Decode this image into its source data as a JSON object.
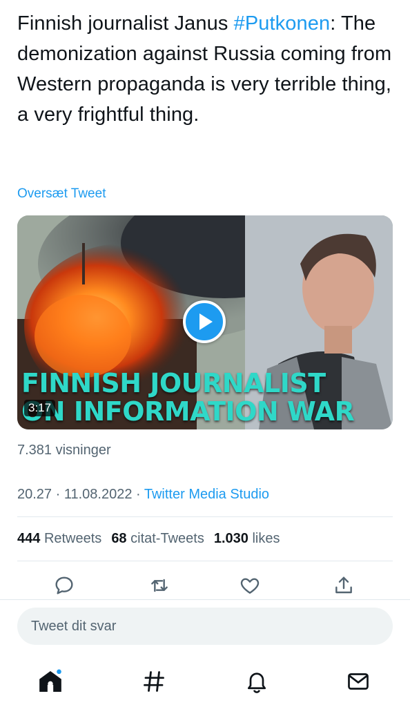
{
  "tweet": {
    "text_line1_prefix": "Finnish journalist Janus ",
    "hashtag": "#Putkonen",
    "text_rest": ": The demonization against Russia coming from Western propaganda is very terrible thing, a very frightful thing.",
    "translate_label": "Oversæt Tweet"
  },
  "video": {
    "caption_line1": "FINNISH JOURNALIST",
    "caption_line2": "ON INFORMATION WAR",
    "duration": "3:17"
  },
  "views_text": "7.381 visninger",
  "meta": {
    "time_date": "20.27 · 11.08.2022 · ",
    "source": "Twitter Media Studio"
  },
  "stats": {
    "retweets_count": "444",
    "retweets_label": "Retweets",
    "quotes_count": "68",
    "quotes_label": "citat-Tweets",
    "likes_count": "1.030",
    "likes_label": "likes"
  },
  "reply": {
    "placeholder": "Tweet dit svar"
  },
  "icons": {
    "reply": "comment-icon",
    "retweet": "retweet-icon",
    "like": "heart-icon",
    "share": "share-icon",
    "home": "home-icon",
    "explore": "hashtag-icon",
    "notifications": "bell-icon",
    "messages": "mail-icon"
  },
  "colors": {
    "accent": "#1d9bf0",
    "text": "#0f1419",
    "muted": "#536471",
    "caption": "#2fd8c8"
  }
}
